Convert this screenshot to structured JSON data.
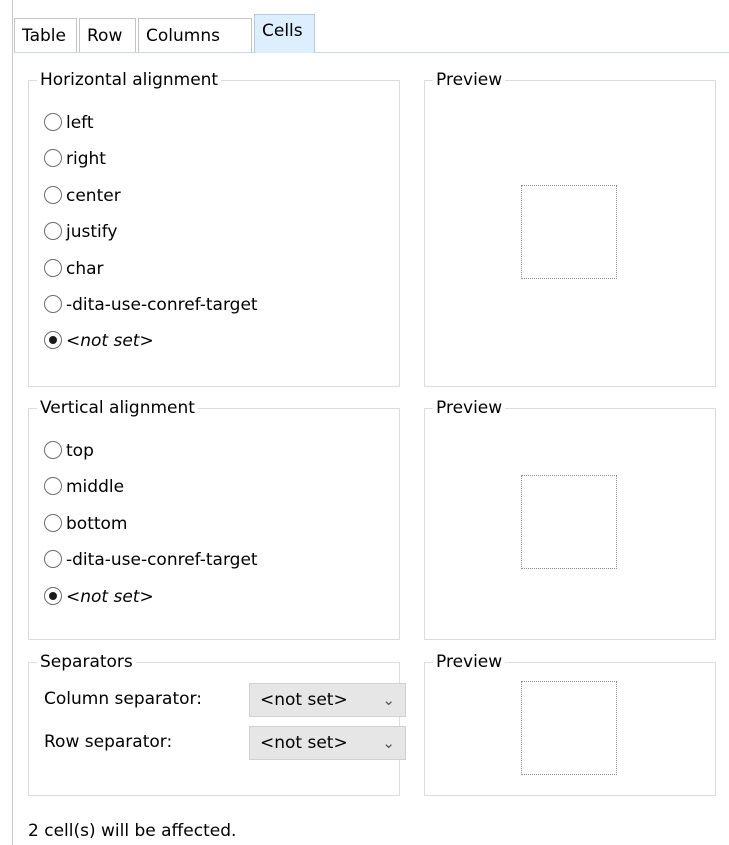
{
  "tabs": [
    {
      "label": "Table",
      "active": false
    },
    {
      "label": "Row",
      "active": false
    },
    {
      "label": "Columns",
      "active": false
    },
    {
      "label": "Cells",
      "active": true
    }
  ],
  "horizontal": {
    "legend": "Horizontal alignment",
    "options": [
      {
        "label": "left",
        "checked": false
      },
      {
        "label": "right",
        "checked": false
      },
      {
        "label": "center",
        "checked": false
      },
      {
        "label": "justify",
        "checked": false
      },
      {
        "label": "char",
        "checked": false
      },
      {
        "label": "-dita-use-conref-target",
        "checked": false
      },
      {
        "label": "<not set>",
        "checked": true
      }
    ]
  },
  "vertical": {
    "legend": "Vertical alignment",
    "options": [
      {
        "label": "top",
        "checked": false
      },
      {
        "label": "middle",
        "checked": false
      },
      {
        "label": "bottom",
        "checked": false
      },
      {
        "label": "-dita-use-conref-target",
        "checked": false
      },
      {
        "label": "<not set>",
        "checked": true
      }
    ]
  },
  "separators": {
    "legend": "Separators",
    "column_label": "Column separator:",
    "column_value": "<not set>",
    "row_label": "Row separator:",
    "row_value": "<not set>"
  },
  "preview_legend": "Preview",
  "status": "2 cell(s) will be affected.",
  "icons": {
    "dropdown": "chevron-down-icon",
    "radio": "radio-button"
  }
}
